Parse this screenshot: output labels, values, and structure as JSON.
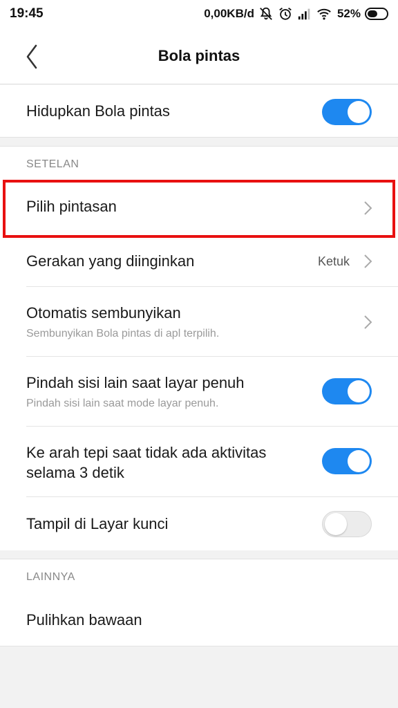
{
  "status_bar": {
    "time": "19:45",
    "net_speed": "0,00KB/d",
    "battery_percent": "52%",
    "battery_level": 0.52,
    "icons": [
      "bell-off-icon",
      "alarm-icon",
      "signal-icon",
      "wifi-icon",
      "battery-icon"
    ]
  },
  "header": {
    "title": "Bola pintas",
    "back_icon": "chevron-left-icon"
  },
  "main_toggle": {
    "label": "Hidupkan Bola pintas",
    "on": true
  },
  "settings_section": {
    "header": "SETELAN",
    "items": [
      {
        "title": "Pilih pintasan",
        "type": "link"
      },
      {
        "title": "Gerakan yang diinginkan",
        "value": "Ketuk",
        "type": "link"
      },
      {
        "title": "Otomatis sembunyikan",
        "subtitle": "Sembunyikan Bola pintas di apl terpilih.",
        "type": "link"
      },
      {
        "title": "Pindah sisi lain saat layar penuh",
        "subtitle": "Pindah sisi lain saat mode layar penuh.",
        "type": "toggle",
        "on": true
      },
      {
        "title_line1": "Ke arah tepi saat tidak ada aktivitas",
        "title_line2": "selama 3 detik",
        "type": "toggle",
        "on": true
      },
      {
        "title": "Tampil di Layar kunci",
        "type": "toggle",
        "on": false
      }
    ]
  },
  "other_section": {
    "header": "LAINNYA",
    "items": [
      {
        "title": "Pulihkan bawaan"
      }
    ]
  },
  "colors": {
    "toggle_on": "#1e88f0",
    "highlight": "#e81010"
  }
}
